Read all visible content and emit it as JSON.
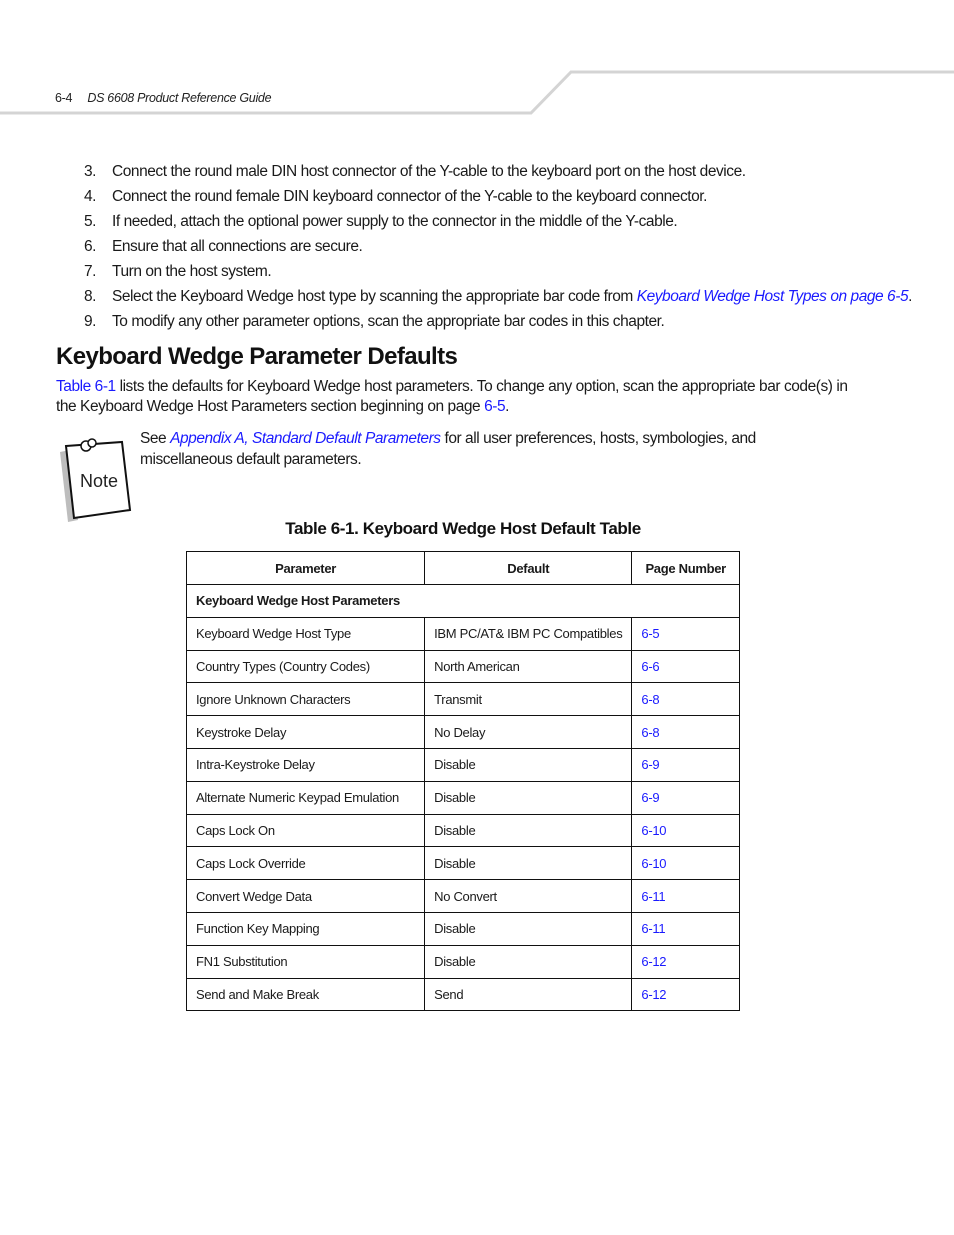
{
  "header": {
    "page_number": "6-4",
    "guide_title": "DS 6608 Product Reference Guide"
  },
  "steps": [
    {
      "num": "3.",
      "text": "Connect the round male DIN host connector of the Y-cable to the keyboard port on the host device."
    },
    {
      "num": "4.",
      "text": "Connect the round female DIN keyboard connector of the Y-cable to the keyboard connector."
    },
    {
      "num": "5.",
      "text": "If needed, attach the optional power supply to the connector in the middle of the Y-cable."
    },
    {
      "num": "6.",
      "text": "Ensure that all connections are secure."
    },
    {
      "num": "7.",
      "text": "Turn on the host system."
    },
    {
      "num": "8.",
      "text": "Select the Keyboard Wedge host type by scanning the appropriate bar code from ",
      "link": "Keyboard Wedge Host Types on page 6-5",
      "after": "."
    },
    {
      "num": "9.",
      "text": "To modify any other parameter options, scan the appropriate bar codes in this chapter."
    }
  ],
  "section": {
    "title": "Keyboard Wedge Parameter Defaults",
    "intro_link": "Table 6-1",
    "intro_text": " lists the defaults for Keyboard Wedge host parameters. To change any option, scan the appropriate bar code(s) in the Keyboard Wedge Host Parameters section beginning on page ",
    "intro_page_link": "6-5",
    "intro_end": "."
  },
  "note": {
    "icon_label": "Note",
    "prefix": "See ",
    "link": "Appendix A, Standard Default Parameters",
    "text": " for all user preferences, hosts, symbologies, and miscellaneous default parameters."
  },
  "table": {
    "caption": "Table 6-1. Keyboard Wedge Host Default Table",
    "headers": [
      "Parameter",
      "Default",
      "Page Number"
    ],
    "group": "Keyboard Wedge Host Parameters",
    "rows": [
      {
        "parameter": "Keyboard Wedge Host Type",
        "default": "IBM PC/AT& IBM PC Compatibles",
        "page": "6-5"
      },
      {
        "parameter": "Country Types (Country Codes)",
        "default": "North American",
        "page": "6-6"
      },
      {
        "parameter": "Ignore Unknown Characters",
        "default": "Transmit",
        "page": "6-8"
      },
      {
        "parameter": "Keystroke Delay",
        "default": "No Delay",
        "page": "6-8"
      },
      {
        "parameter": "Intra-Keystroke Delay",
        "default": "Disable",
        "page": "6-9"
      },
      {
        "parameter": "Alternate Numeric Keypad Emulation",
        "default": "Disable",
        "page": "6-9"
      },
      {
        "parameter": "Caps Lock On",
        "default": "Disable",
        "page": "6-10"
      },
      {
        "parameter": "Caps Lock Override",
        "default": "Disable",
        "page": "6-10"
      },
      {
        "parameter": "Convert Wedge Data",
        "default": "No Convert",
        "page": "6-11"
      },
      {
        "parameter": "Function Key Mapping",
        "default": "Disable",
        "page": "6-11"
      },
      {
        "parameter": "FN1 Substitution",
        "default": "Disable",
        "page": "6-12"
      },
      {
        "parameter": "Send and Make Break",
        "default": "Send",
        "page": "6-12"
      }
    ]
  },
  "colors": {
    "link": "#1a1aff",
    "text": "#1a1a1a",
    "header_rule": "#d4d4d4"
  }
}
